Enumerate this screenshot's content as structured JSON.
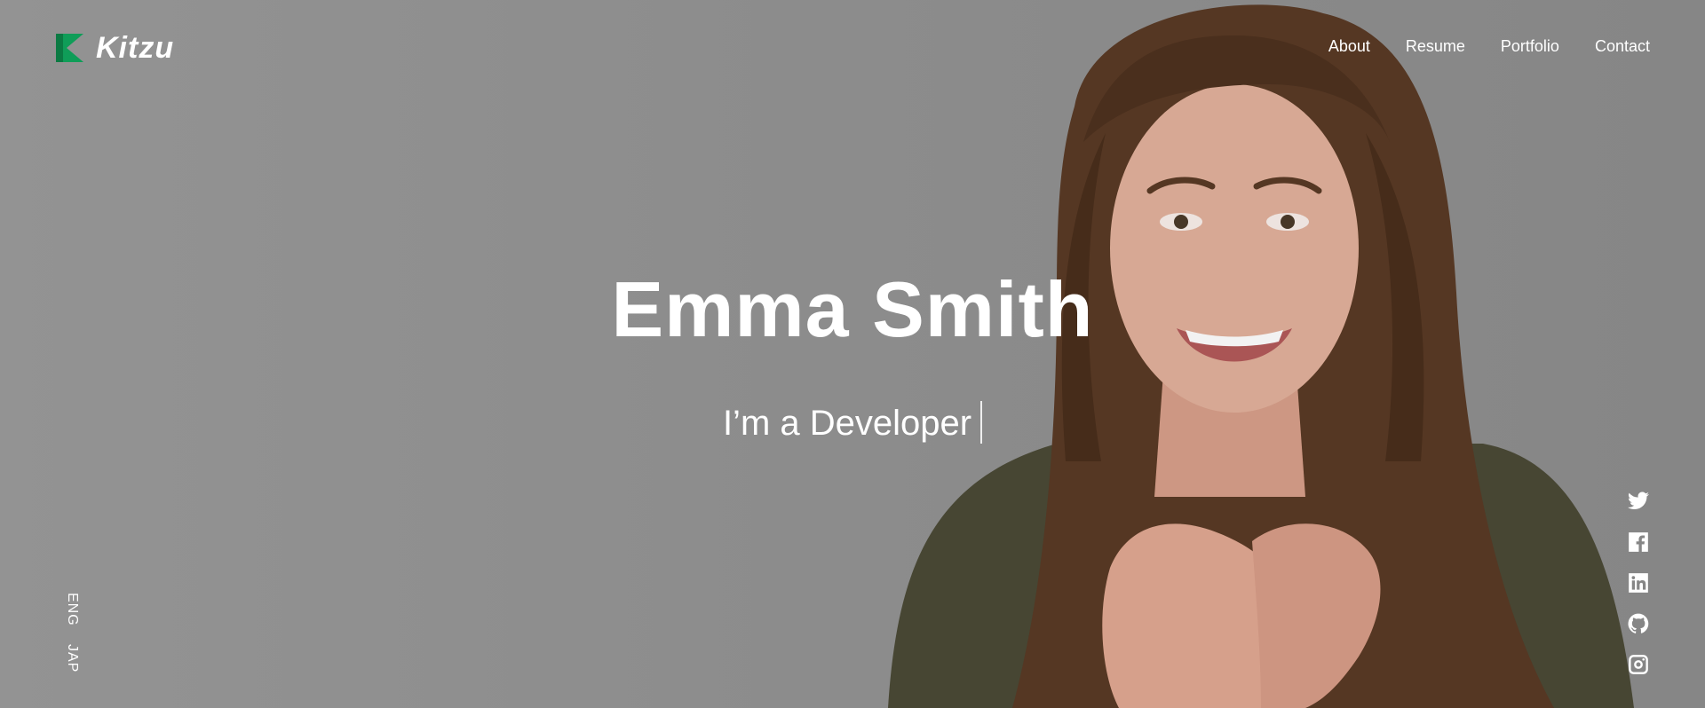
{
  "brand": {
    "name": "Kitzu",
    "accent_color": "#0f9d58",
    "accent_dark": "#0b7a43"
  },
  "nav": {
    "items": [
      {
        "label": "About"
      },
      {
        "label": "Resume"
      },
      {
        "label": "Portfolio"
      },
      {
        "label": "Contact"
      }
    ]
  },
  "hero": {
    "name": "Emma Smith",
    "tagline": "I’m a Developer",
    "background_color": "#959595"
  },
  "language": {
    "options": [
      "ENG",
      "JAP"
    ]
  },
  "social": {
    "icons": [
      "twitter-icon",
      "facebook-icon",
      "linkedin-icon",
      "github-icon",
      "instagram-icon"
    ]
  }
}
